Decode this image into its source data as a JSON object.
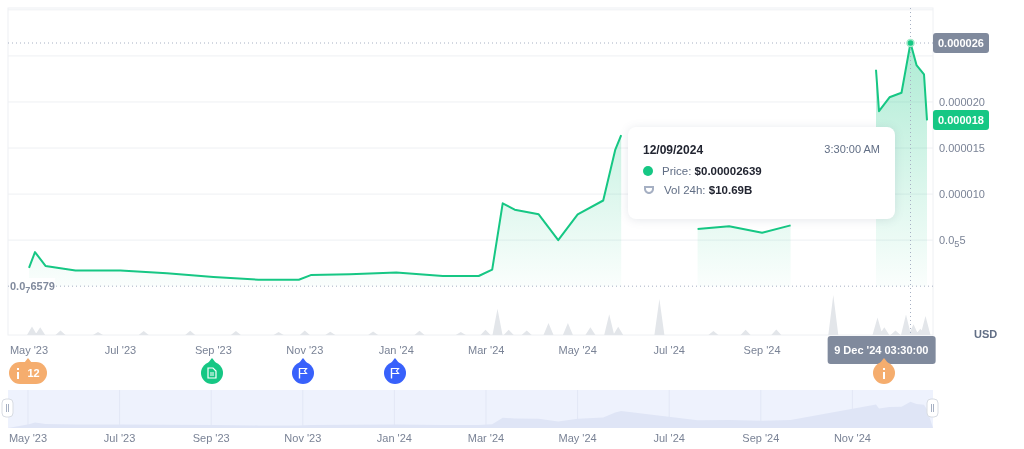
{
  "chart": {
    "chart_data": {
      "type": "area",
      "xlim": [
        "2023-04-17",
        "2024-12-24"
      ],
      "ylim": [
        -5.3e-06,
        3.02e-05
      ],
      "grid": true,
      "x": [
        "2023-05-01",
        "2023-05-05",
        "2023-05-12",
        "2023-06-01",
        "2023-07-01",
        "2023-08-01",
        "2023-09-01",
        "2023-10-01",
        "2023-10-28",
        "2023-11-05",
        "2023-12-01",
        "2024-01-01",
        "2024-02-01",
        "2024-02-25",
        "2024-03-05",
        "2024-03-12",
        "2024-03-20",
        "2024-04-05",
        "2024-04-18",
        "2024-05-01",
        "2024-05-18",
        "2024-05-26",
        "2024-05-30",
        "2024-06-05",
        "2024-07-20",
        "2024-08-10",
        "2024-09-01",
        "2024-09-20",
        "2024-10-15",
        "2024-11-16",
        "2024-11-18",
        "2024-11-25",
        "2024-12-03",
        "2024-12-09",
        "2024-12-13",
        "2024-12-18",
        "2024-12-20"
      ],
      "series": [
        {
          "color": "#16c784",
          "values": [
            2e-06,
            3.7e-06,
            2.2e-06,
            1.7e-06,
            1.7e-06,
            1.4e-06,
            1e-06,
            7e-07,
            7e-07,
            1.2e-06,
            1.3e-06,
            1.5e-06,
            1.1e-06,
            1.1e-06,
            1.8e-06,
            9e-06,
            8.3e-06,
            7.8e-06,
            5e-06,
            7.8e-06,
            9.3e-06,
            1.48e-05,
            1.64e-05,
            null,
            6.2e-06,
            6.5e-06,
            5.8e-06,
            6.6e-06,
            null,
            2.35e-05,
            1.9e-05,
            2.05e-05,
            2.1e-05,
            2.64e-05,
            2.4e-05,
            2.3e-05,
            1.8e-05
          ]
        }
      ],
      "xticks": [
        {
          "value": "2023-05-01",
          "label": "May '23"
        },
        {
          "value": "2023-07-01",
          "label": "Jul '23"
        },
        {
          "value": "2023-09-01",
          "label": "Sep '23"
        },
        {
          "value": "2023-11-01",
          "label": "Nov '23"
        },
        {
          "value": "2024-01-01",
          "label": "Jan '24"
        },
        {
          "value": "2024-03-01",
          "label": "Mar '24"
        },
        {
          "value": "2024-05-01",
          "label": "May '24"
        },
        {
          "value": "2024-07-01",
          "label": "Jul '24"
        },
        {
          "value": "2024-09-01",
          "label": "Sep '24"
        }
      ],
      "yticks": [
        {
          "value": 5e-06,
          "label": "0.0$_{5}$5"
        },
        {
          "value": 1e-05,
          "label": "0.000010"
        },
        {
          "value": 1.5e-05,
          "label": "0.000015"
        },
        {
          "value": 2e-05,
          "label": "0.000020"
        }
      ],
      "annotations": [
        "0.000018",
        "9 Dec '24 03:30:00"
      ]
    },
    "low_label": "0.0$_{7}$6579",
    "high_label": "0.000026",
    "currency": "USD",
    "tooltip": {
      "date": "12/09/2024",
      "time": "3:30:00 AM",
      "rows": [
        {
          "kind": "price",
          "text": "Price: **$0.00002639**"
        },
        {
          "kind": "volume",
          "text": "Vol 24h: **$10.69B**"
        }
      ]
    }
  },
  "events": [
    {
      "kind": "info",
      "text": "12",
      "color": "#f5ad6e"
    },
    {
      "kind": "document",
      "color": "#16c784"
    },
    {
      "kind": "flag",
      "color": "#3861fb"
    },
    {
      "kind": "flag",
      "color": "#3861fb"
    },
    {
      "kind": "info",
      "color": "#f5ad6e"
    }
  ],
  "navigator": {
    "labels": [
      "May '23",
      "Jul '23",
      "Sep '23",
      "Nov '23",
      "Jan '24",
      "Mar '24",
      "May '24",
      "Jul '24",
      "Sep '24",
      "Nov '24"
    ]
  }
}
